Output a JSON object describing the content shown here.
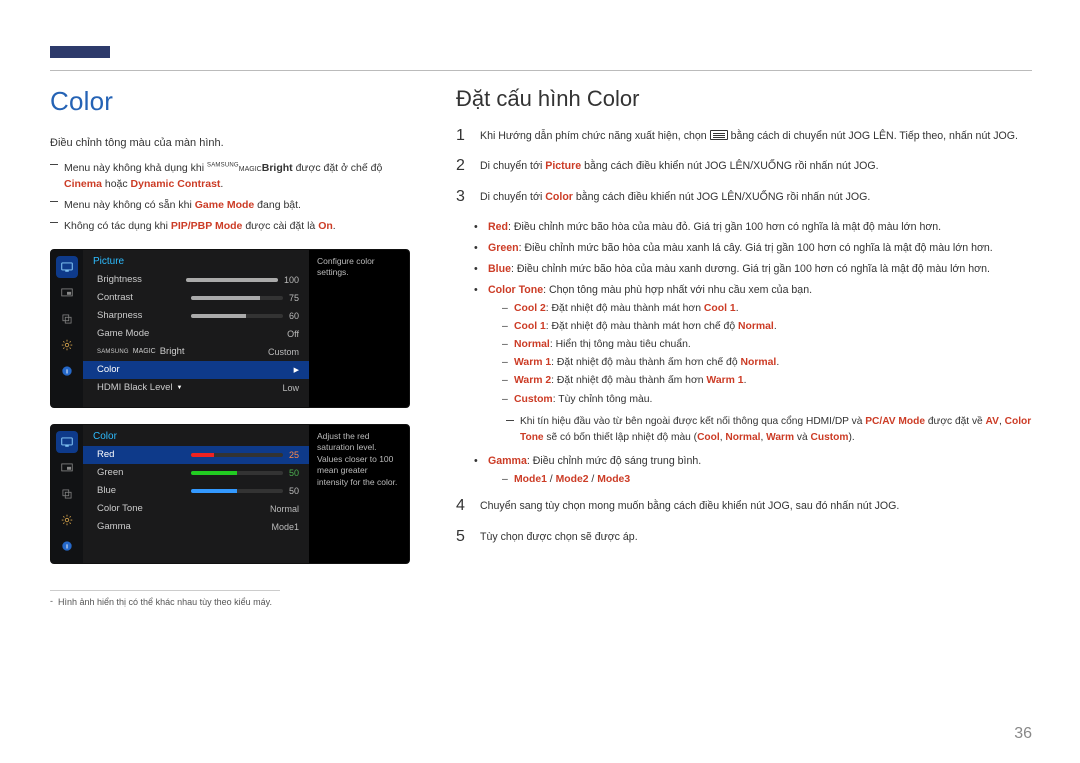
{
  "page_number": "36",
  "left": {
    "title": "Color",
    "intro": "Điều chỉnh tông màu của màn hình.",
    "note1_pre": "Menu này không khả dụng khi ",
    "note1_magic": "Bright",
    "note1_mid": " được đặt ở chế độ ",
    "note1_cinema": "Cinema",
    "note1_or": " hoặc ",
    "note1_dc": "Dynamic Contrast",
    "note1_end": ".",
    "note2_pre": "Menu này không có sẵn khi ",
    "note2_game": "Game Mode",
    "note2_end": " đang bật.",
    "note3_pre": "Không có tác dụng khi ",
    "note3_pip": "PIP/PBP Mode",
    "note3_mid": " được cài đặt là ",
    "note3_on": "On",
    "note3_end": ".",
    "footnote": "Hình ảnh hiển thị có thể khác nhau tùy theo kiểu máy."
  },
  "osd1": {
    "title": "Picture",
    "tip": "Configure color settings.",
    "rows": {
      "brightness": {
        "label": "Brightness",
        "value": "100",
        "pct": 100
      },
      "contrast": {
        "label": "Contrast",
        "value": "75",
        "pct": 75
      },
      "sharpness": {
        "label": "Sharpness",
        "value": "60",
        "pct": 60
      },
      "gamemode": {
        "label": "Game Mode",
        "value": "Off"
      },
      "magic": {
        "label": "Bright",
        "prefix": "MAGIC",
        "sup": "SAMSUNG",
        "value": "Custom"
      },
      "color": {
        "label": "Color",
        "value": ""
      },
      "hdmi": {
        "label": "HDMI Black Level",
        "value": "Low"
      }
    }
  },
  "osd2": {
    "title": "Color",
    "tip": "Adjust the red saturation level. Values closer to 100 mean greater intensity for the color.",
    "rows": {
      "red": {
        "label": "Red",
        "value": "25",
        "pct": 25
      },
      "green": {
        "label": "Green",
        "value": "50",
        "pct": 50
      },
      "blue": {
        "label": "Blue",
        "value": "50",
        "pct": 50
      },
      "tone": {
        "label": "Color Tone",
        "value": "Normal"
      },
      "gamma": {
        "label": "Gamma",
        "value": "Mode1"
      }
    }
  },
  "right": {
    "title": "Đặt cấu hình Color",
    "step1_num": "1",
    "step1_a": "Khi Hướng dẫn phím chức năng xuất hiện, chọn ",
    "step1_b": " bằng cách di chuyển nút JOG LÊN. Tiếp theo, nhấn nút JOG.",
    "step2_num": "2",
    "step2_a": "Di chuyển tới ",
    "step2_pic": "Picture",
    "step2_b": " bằng cách điều khiển nút JOG LÊN/XUỐNG rồi nhấn nút JOG.",
    "step3_num": "3",
    "step3_a": "Di chuyển tới ",
    "step3_col": "Color",
    "step3_b": " bằng cách điều khiển nút JOG LÊN/XUỐNG rồi nhấn nút JOG.",
    "b_red_k": "Red",
    "b_red_v": ": Điều chỉnh mức bão hòa của màu đỏ. Giá trị gần 100 hơn có nghĩa là mật độ màu lớn hơn.",
    "b_green_k": "Green",
    "b_green_v": ": Điều chỉnh mức bão hòa của màu xanh lá cây. Giá trị gần 100 hơn có nghĩa là mật độ màu lớn hơn.",
    "b_blue_k": "Blue",
    "b_blue_v": ": Điều chỉnh mức bão hòa của màu xanh dương. Giá trị gần 100 hơn có nghĩa là mật độ màu lớn hơn.",
    "b_tone_k": "Color Tone",
    "b_tone_v": ": Chọn tông màu phù hợp nhất với nhu cầu xem của bạn.",
    "tone_cool2_k": "Cool 2",
    "tone_cool2_v": ": Đặt nhiệt độ màu thành mát hơn ",
    "tone_cool2_t": "Cool 1",
    "tone_cool1_k": "Cool 1",
    "tone_cool1_v": ": Đặt nhiệt độ màu thành mát hơn chế độ ",
    "tone_cool1_t": "Normal",
    "tone_norm_k": "Normal",
    "tone_norm_v": ": Hiển thị tông màu tiêu chuẩn.",
    "tone_warm1_k": "Warm 1",
    "tone_warm1_v": ": Đặt nhiệt độ màu thành ấm hơn chế độ ",
    "tone_warm1_t": "Normal",
    "tone_warm2_k": "Warm 2",
    "tone_warm2_v": ": Đặt nhiệt độ màu thành ấm hơn ",
    "tone_warm2_t": "Warm 1",
    "tone_custom_k": "Custom",
    "tone_custom_v": ": Tùy chỉnh tông màu.",
    "lnote_a": "Khi tín hiệu đầu vào từ bên ngoài được kết nối thông qua cổng HDMI/DP và ",
    "lnote_k1": "PC/AV Mode",
    "lnote_b": " được đặt về ",
    "lnote_k2": "AV",
    "lnote_c": ", ",
    "lnote_k3": "Color Tone",
    "lnote_d": " sẽ có bốn thiết lập nhiệt độ màu (",
    "lnote_cool": "Cool",
    "lnote_sep1": ", ",
    "lnote_norm": "Normal",
    "lnote_sep2": ", ",
    "lnote_warm": "Warm",
    "lnote_and": " và ",
    "lnote_cust": "Custom",
    "lnote_e": ").",
    "b_gamma_k": "Gamma",
    "b_gamma_v": ": Điều chỉnh mức độ sáng trung bình.",
    "gamma_m1": "Mode1",
    "gamma_sep": " / ",
    "gamma_m2": "Mode2",
    "gamma_m3": "Mode3",
    "step4_num": "4",
    "step4": "Chuyển sang tùy chọn mong muốn bằng cách điều khiển nút JOG, sau đó nhấn nút JOG.",
    "step5_num": "5",
    "step5": "Tùy chọn được chọn sẽ được áp."
  }
}
